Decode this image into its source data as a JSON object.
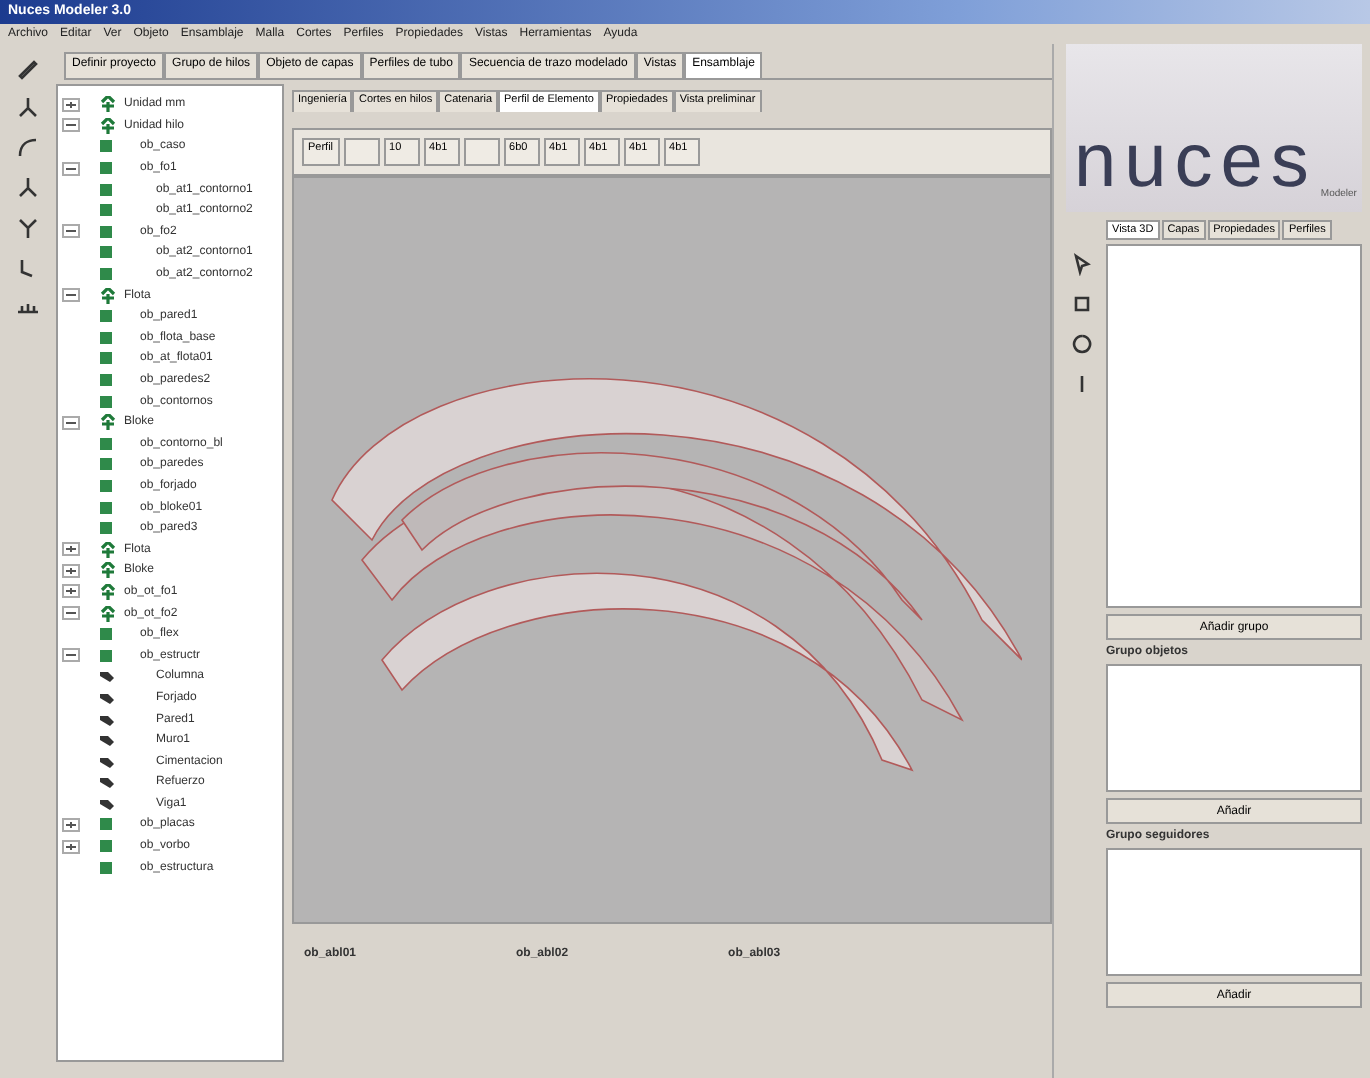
{
  "window": {
    "title": "Nuces Modeler 3.0"
  },
  "menu": [
    "Archivo",
    "Editar",
    "Ver",
    "Objeto",
    "Ensamblaje",
    "Malla",
    "Cortes",
    "Perfiles",
    "Propiedades",
    "Vistas",
    "Herramientas",
    "Ayuda"
  ],
  "main_tabs": [
    {
      "label": "Definir proyecto",
      "selected": false
    },
    {
      "label": "Grupo de hilos",
      "selected": false
    },
    {
      "label": "Objeto de capas",
      "selected": false
    },
    {
      "label": "Perfiles de tubo",
      "selected": false
    },
    {
      "label": "Secuencia de trazo modelado",
      "selected": false
    },
    {
      "label": "Vistas",
      "selected": false
    },
    {
      "label": "Ensamblaje",
      "selected": true
    }
  ],
  "tree": [
    {
      "label": "Unidad mm",
      "kind": "group",
      "expanded": false
    },
    {
      "label": "Unidad hilo",
      "kind": "group",
      "expanded": true,
      "children": [
        {
          "label": "ob_caso",
          "kind": "part"
        },
        {
          "label": "ob_fo1",
          "kind": "part",
          "expanded": true,
          "children": [
            {
              "label": "ob_at1_contorno1",
              "kind": "part"
            },
            {
              "label": "ob_at1_contorno2",
              "kind": "part"
            }
          ]
        },
        {
          "label": "ob_fo2",
          "kind": "part",
          "expanded": true,
          "children": [
            {
              "label": "ob_at2_contorno1",
              "kind": "part"
            },
            {
              "label": "ob_at2_contorno2",
              "kind": "part"
            }
          ]
        }
      ]
    },
    {
      "label": "Flota",
      "kind": "group",
      "expanded": true,
      "children": [
        {
          "label": "ob_pared1",
          "kind": "part"
        },
        {
          "label": "ob_flota_base",
          "kind": "part"
        },
        {
          "label": "ob_at_flota01",
          "kind": "part"
        },
        {
          "label": "ob_paredes2",
          "kind": "part"
        },
        {
          "label": "ob_contornos",
          "kind": "part"
        }
      ]
    },
    {
      "label": "Bloke",
      "kind": "group",
      "expanded": true,
      "children": [
        {
          "label": "ob_contorno_bl",
          "kind": "part"
        },
        {
          "label": "ob_paredes",
          "kind": "part"
        },
        {
          "label": "ob_forjado",
          "kind": "part"
        },
        {
          "label": "ob_bloke01",
          "kind": "part"
        },
        {
          "label": "ob_pared3",
          "kind": "part"
        }
      ]
    },
    {
      "label": "Flota",
      "kind": "group",
      "expanded": false
    },
    {
      "label": "Bloke",
      "kind": "group",
      "expanded": false
    },
    {
      "label": "ob_ot_fo1",
      "kind": "group",
      "expanded": false
    },
    {
      "label": "ob_ot_fo2",
      "kind": "group",
      "expanded": true,
      "children": [
        {
          "label": "ob_flex",
          "kind": "part"
        },
        {
          "label": "ob_estructr",
          "kind": "part",
          "expanded": true,
          "children": [
            {
              "label": "Columna",
              "kind": "piece"
            },
            {
              "label": "Forjado",
              "kind": "piece"
            },
            {
              "label": "Pared1",
              "kind": "piece"
            },
            {
              "label": "Muro1",
              "kind": "piece"
            },
            {
              "label": "Cimentacion",
              "kind": "piece"
            },
            {
              "label": "Refuerzo",
              "kind": "piece"
            },
            {
              "label": "Viga1",
              "kind": "piece"
            }
          ]
        },
        {
          "label": "ob_placas",
          "kind": "part",
          "expanded": false
        },
        {
          "label": "ob_vorbo",
          "kind": "part",
          "expanded": false
        },
        {
          "label": "ob_estructura",
          "kind": "part"
        }
      ]
    }
  ],
  "sub_tabs": [
    {
      "label": "Ingeniería",
      "selected": false
    },
    {
      "label": "Cortes en hilos",
      "selected": false
    },
    {
      "label": "Catenaria",
      "selected": false
    },
    {
      "label": "Perfil de Elemento",
      "selected": true
    },
    {
      "label": "Propiedades",
      "selected": false
    },
    {
      "label": "Vista preliminar",
      "selected": false
    }
  ],
  "profile_header": [
    {
      "kind": "text",
      "text": "Perfil"
    },
    {
      "kind": "blank"
    },
    {
      "kind": "text",
      "text": "10"
    },
    {
      "kind": "text",
      "text": "4b1"
    },
    {
      "kind": "blank"
    },
    {
      "kind": "text",
      "text": "6b0"
    },
    {
      "kind": "text",
      "text": "4b1"
    },
    {
      "kind": "text",
      "text": "4b1"
    },
    {
      "kind": "text",
      "text": "4b1"
    },
    {
      "kind": "text",
      "text": "4b1"
    }
  ],
  "view_labels": [
    "ob_abl01",
    "ob_abl02",
    "ob_abl03"
  ],
  "logo": {
    "text": "nuces",
    "sub": "Modeler"
  },
  "right_tabs": [
    {
      "label": "Vista 3D",
      "selected": true
    },
    {
      "label": "Capas",
      "selected": false
    },
    {
      "label": "Propiedades",
      "selected": false
    },
    {
      "label": "Perfiles",
      "selected": false
    }
  ],
  "right_buttons": [
    "Añadir grupo",
    "Grupo objetos",
    "Añadir",
    "Grupo seguidores",
    "Añadir"
  ]
}
